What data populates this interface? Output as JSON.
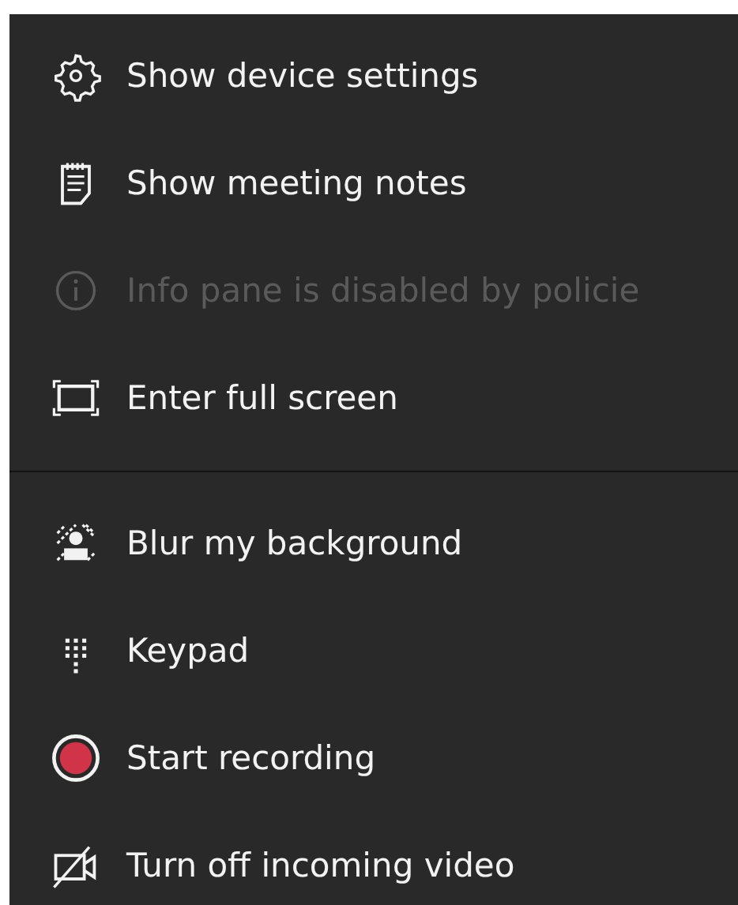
{
  "sections": [
    {
      "items": [
        {
          "kind": "settings",
          "label": "Show device settings",
          "disabled": false
        },
        {
          "kind": "notes",
          "label": "Show meeting notes",
          "disabled": false
        },
        {
          "kind": "info",
          "label": "Info pane is disabled by policie",
          "disabled": true
        },
        {
          "kind": "fullscreen",
          "label": "Enter full screen",
          "disabled": false
        }
      ]
    },
    {
      "items": [
        {
          "kind": "blur",
          "label": "Blur my background",
          "disabled": false
        },
        {
          "kind": "keypad",
          "label": "Keypad",
          "disabled": false
        },
        {
          "kind": "record",
          "label": "Start recording",
          "disabled": false
        },
        {
          "kind": "video-off",
          "label": "Turn off incoming video",
          "disabled": false
        }
      ]
    }
  ]
}
